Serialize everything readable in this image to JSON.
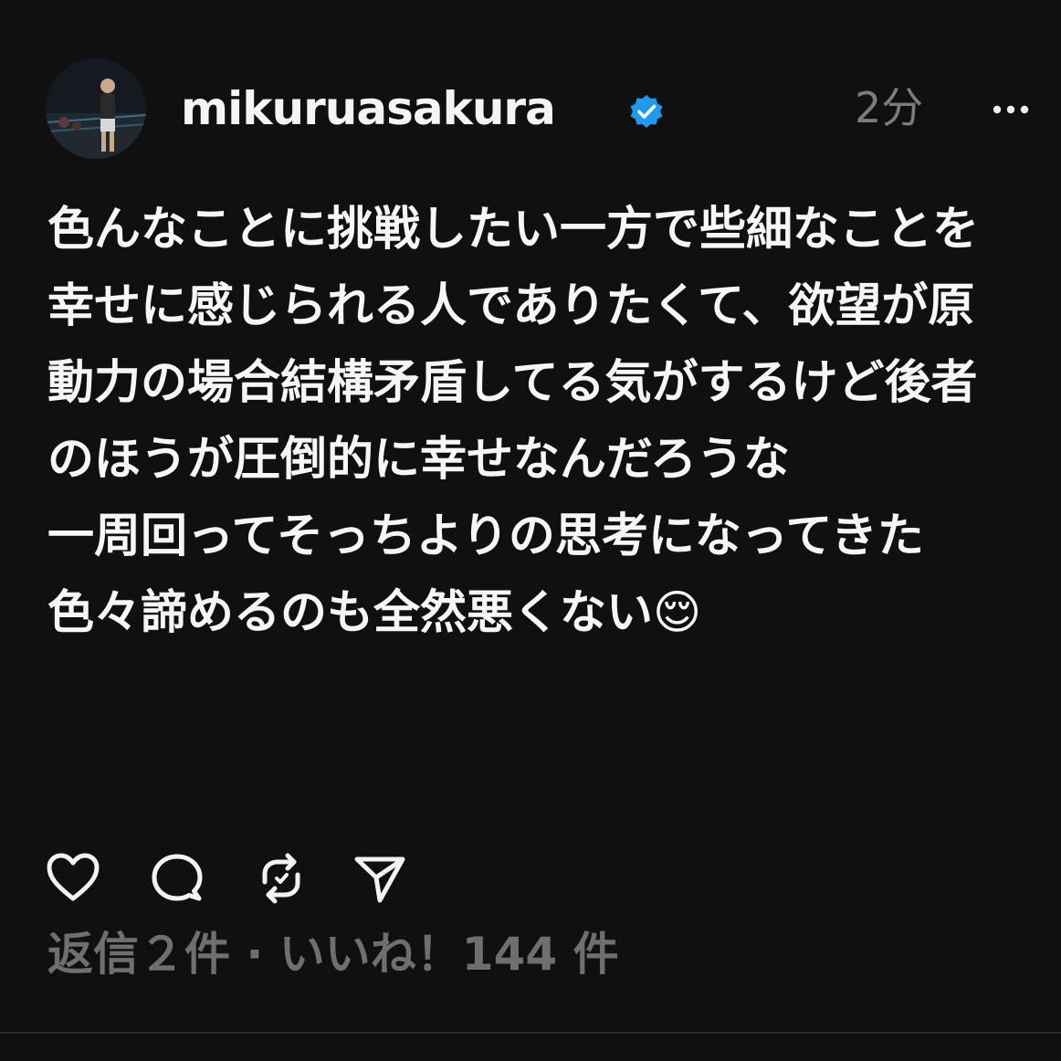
{
  "post": {
    "username": "mikuruasakura",
    "time": "2分",
    "text": "色んなことに挑戦したい一方で些細なことを幸せに感じられる人でありたくて、欲望が原動力の場合結構矛盾してる気がするけど後者のほうが圧倒的に幸せなんだろうな\n一周回ってそっちよりの思考になってきた\n色々諦めるのも全然悪くない😌",
    "stats": "返信２件 · いいね！144 件"
  },
  "icons": {
    "avatar": "avatar",
    "verified": "verified-badge-icon",
    "more": "more-options-icon",
    "like": "heart-icon",
    "reply": "comment-bubble-icon",
    "repost": "repost-icon",
    "share": "send-icon"
  },
  "colors": {
    "background": "#101010",
    "text": "#f6f6f6",
    "muted": "#7c7c7c",
    "verified": "#1d9bf0"
  }
}
